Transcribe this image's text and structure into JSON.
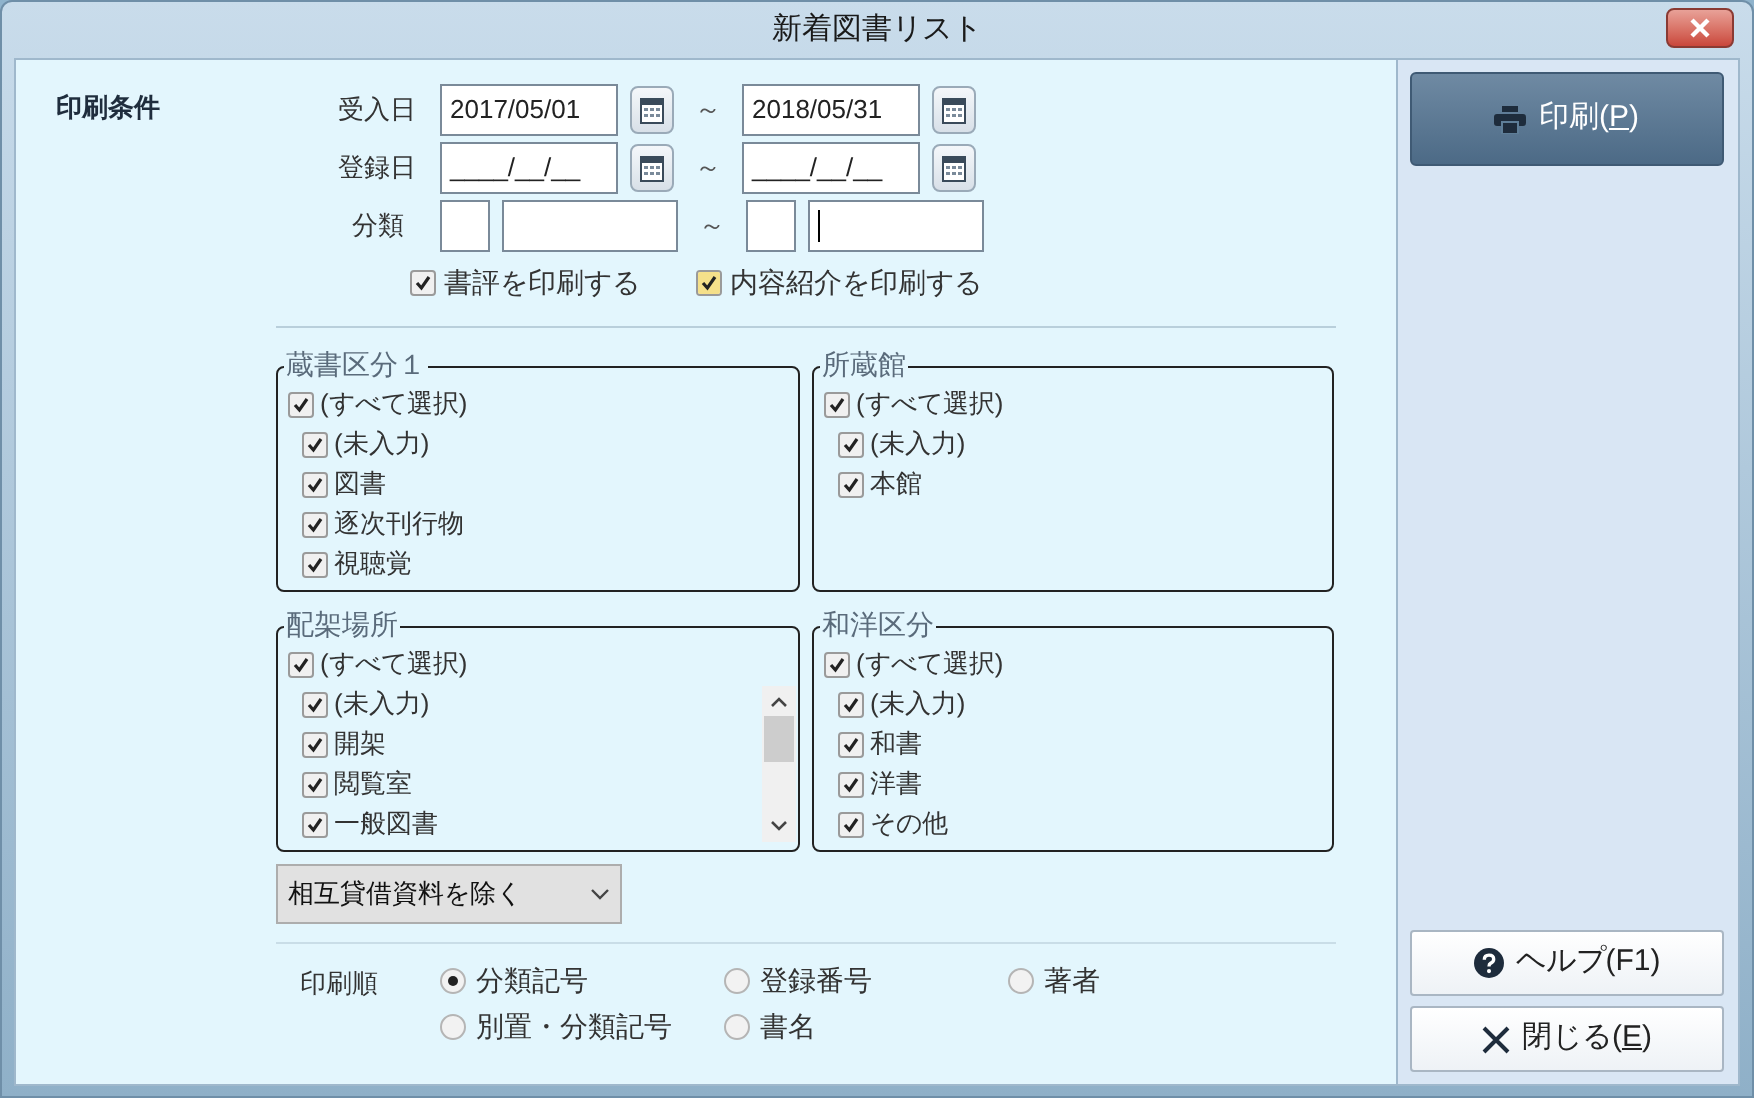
{
  "window": {
    "title": "新着図書リスト"
  },
  "section_label": "印刷条件",
  "date_rows": [
    {
      "label": "受入日",
      "from": "2017/05/01",
      "to": "2018/05/31"
    },
    {
      "label": "登録日",
      "from": "____/__/__",
      "to": "____/__/__"
    }
  ],
  "classification": {
    "label": "分類",
    "separator": "～"
  },
  "date_separator": "～",
  "print_options": [
    {
      "label": "書評を印刷する",
      "checked": true,
      "focused": false
    },
    {
      "label": "内容紹介を印刷する",
      "checked": true,
      "focused": true
    }
  ],
  "groups": [
    {
      "title": "蔵書区分１",
      "scrollable": false,
      "items": [
        {
          "label": "(すべて選択)",
          "checked": true,
          "children": [
            {
              "label": "(未入力)",
              "checked": true
            },
            {
              "label": "図書",
              "checked": true
            },
            {
              "label": "逐次刊行物",
              "checked": true
            },
            {
              "label": "視聴覚",
              "checked": true
            }
          ]
        }
      ]
    },
    {
      "title": "所蔵館",
      "scrollable": false,
      "items": [
        {
          "label": "(すべて選択)",
          "checked": true,
          "children": [
            {
              "label": "(未入力)",
              "checked": true
            },
            {
              "label": "本館",
              "checked": true
            }
          ]
        }
      ]
    },
    {
      "title": "配架場所",
      "scrollable": true,
      "items": [
        {
          "label": "(すべて選択)",
          "checked": true,
          "children": [
            {
              "label": "(未入力)",
              "checked": true
            },
            {
              "label": "開架",
              "checked": true
            },
            {
              "label": "閲覧室",
              "checked": true
            },
            {
              "label": "一般図書",
              "checked": true
            }
          ]
        }
      ]
    },
    {
      "title": "和洋区分",
      "scrollable": false,
      "items": [
        {
          "label": "(すべて選択)",
          "checked": true,
          "children": [
            {
              "label": "(未入力)",
              "checked": true
            },
            {
              "label": "和書",
              "checked": true
            },
            {
              "label": "洋書",
              "checked": true
            },
            {
              "label": "その他",
              "checked": true
            }
          ]
        }
      ]
    }
  ],
  "filter_dropdown": {
    "value": "相互貸借資料を除く"
  },
  "sort_order": {
    "label": "印刷順",
    "options": [
      {
        "label": "分類記号",
        "selected": true
      },
      {
        "label": "登録番号",
        "selected": false
      },
      {
        "label": "著者",
        "selected": false
      },
      {
        "label": "別置・分類記号",
        "selected": false
      },
      {
        "label": "書名",
        "selected": false
      }
    ]
  },
  "buttons": [
    {
      "kind": "print",
      "label": "印刷(",
      "key": "P",
      "tail": ")"
    },
    {
      "kind": "help",
      "label": "ヘルプ(F1)"
    },
    {
      "kind": "close",
      "label": "閉じる(",
      "key": "E",
      "tail": ")"
    }
  ]
}
